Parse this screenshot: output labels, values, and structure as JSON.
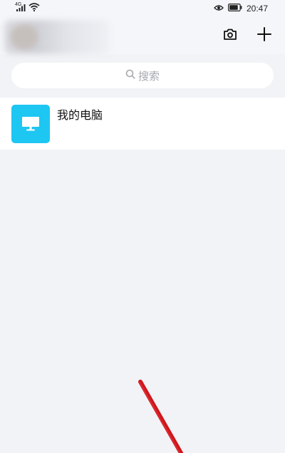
{
  "status_bar": {
    "network": "4G",
    "time": "20:47",
    "icons": [
      "signal-icon",
      "wifi-icon",
      "eye-icon",
      "battery-icon"
    ]
  },
  "header": {
    "camera_icon": "camera-icon",
    "add_icon": "plus-icon"
  },
  "search": {
    "placeholder": "搜索",
    "icon": "search-icon"
  },
  "list": {
    "items": [
      {
        "label": "我的电脑",
        "icon": "computer-icon",
        "icon_color": "#1ec6f2"
      }
    ]
  },
  "colors": {
    "background": "#f1f3f6",
    "accent": "#1ec6f2",
    "annotation": "#d0161c"
  }
}
